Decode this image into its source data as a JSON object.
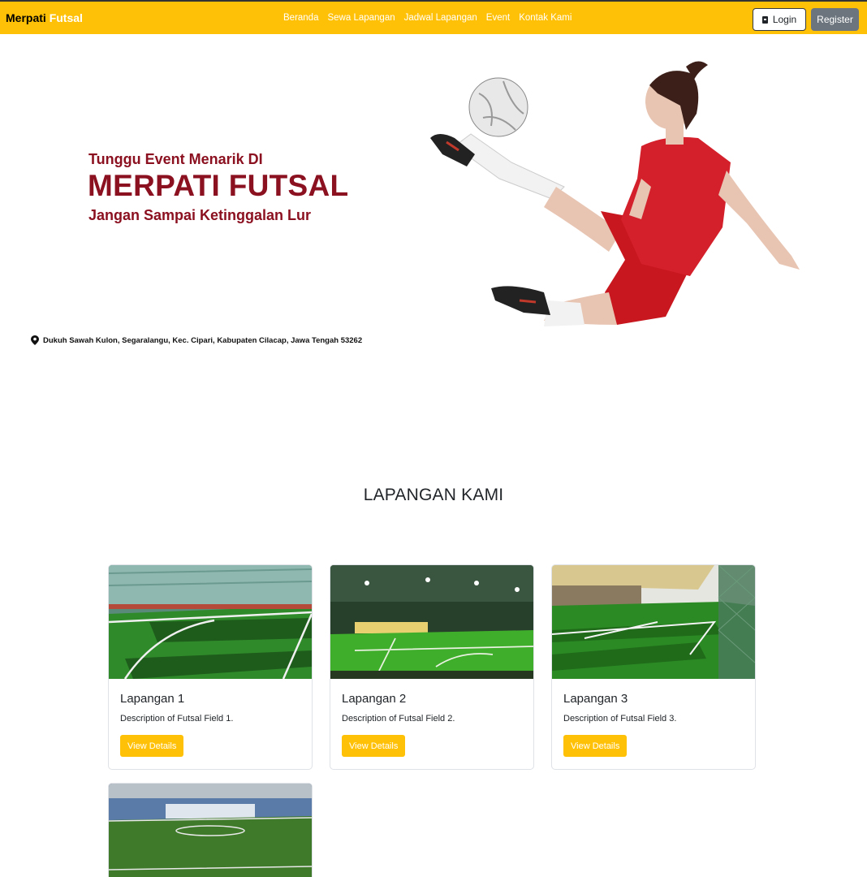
{
  "navbar": {
    "brand_main": "Merpati",
    "brand_accent": "Futsal",
    "links": [
      "Beranda",
      "Sewa Lapangan",
      "Jadwal Lapangan",
      "Event",
      "Kontak Kami"
    ],
    "login_label": "Login",
    "register_label": "Register",
    "accent_color": "#ffc107"
  },
  "hero": {
    "line1": "Tunggu Event Menarik DI",
    "line2": "MERPATI FUTSAL",
    "line3": "Jangan Sampai Ketinggalan Lur",
    "address": "Dukuh Sawah Kulon, Segaralangu, Kec. Cipari, Kabupaten Cilacap, Jawa Tengah 53262",
    "text_color": "#8b1020"
  },
  "fields": {
    "title": "LAPANGAN KAMI",
    "cards": [
      {
        "title": "Lapangan 1",
        "description": "Description of Futsal Field 1.",
        "button": "View Details"
      },
      {
        "title": "Lapangan 2",
        "description": "Description of Futsal Field 2.",
        "button": "View Details"
      },
      {
        "title": "Lapangan 3",
        "description": "Description of Futsal Field 3.",
        "button": "View Details"
      }
    ]
  }
}
